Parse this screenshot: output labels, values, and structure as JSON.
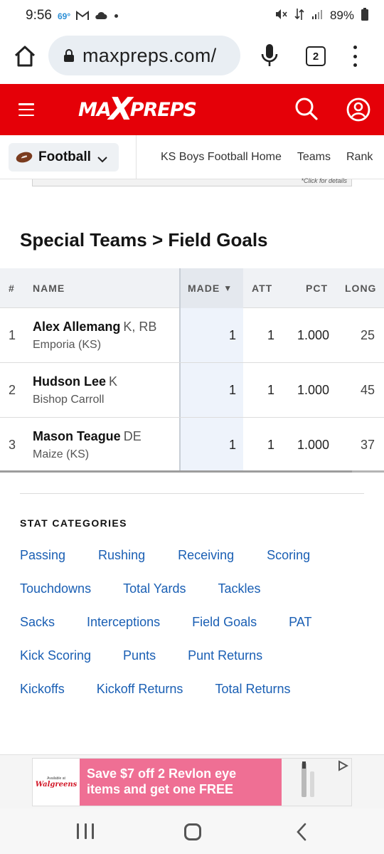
{
  "status": {
    "time": "9:56",
    "temperature": "69°",
    "battery": "89%"
  },
  "browser": {
    "url": "maxpreps.com/",
    "tab_count": "2"
  },
  "header": {
    "logo_left": "MA",
    "logo_x": "X",
    "logo_right": "PREPS"
  },
  "subnav": {
    "sport": "Football",
    "links": [
      "KS Boys Football Home",
      "Teams",
      "Rank"
    ]
  },
  "ad_top": {
    "text": "*Click for details"
  },
  "page": {
    "title": "Special Teams > Field Goals"
  },
  "table": {
    "headers": {
      "num": "#",
      "name": "NAME",
      "made": "MADE",
      "sort_indicator": "▼",
      "att": "ATT",
      "pct": "PCT",
      "long": "LONG"
    },
    "rows": [
      {
        "rank": "1",
        "name": "Alex Allemang",
        "position": "K, RB",
        "school": "Emporia (KS)",
        "made": "1",
        "att": "1",
        "pct": "1.000",
        "long": "25"
      },
      {
        "rank": "2",
        "name": "Hudson Lee",
        "position": "K",
        "school": "Bishop Carroll",
        "made": "1",
        "att": "1",
        "pct": "1.000",
        "long": "45"
      },
      {
        "rank": "3",
        "name": "Mason Teague",
        "position": "DE",
        "school": "Maize (KS)",
        "made": "1",
        "att": "1",
        "pct": "1.000",
        "long": "37"
      }
    ]
  },
  "categories": {
    "heading": "STAT CATEGORIES",
    "rows": [
      [
        "Passing",
        "Rushing",
        "Receiving",
        "Scoring"
      ],
      [
        "Touchdowns",
        "Total Yards",
        "Tackles"
      ],
      [
        "Sacks",
        "Interceptions",
        "Field Goals",
        "PAT"
      ],
      [
        "Kick Scoring",
        "Punts",
        "Punt Returns"
      ],
      [
        "Kickoffs",
        "Kickoff Returns",
        "Total Returns"
      ]
    ]
  },
  "ad_bottom": {
    "available_at": "Available at",
    "brand": "Walgreens",
    "line1": "Save $7 off 2 Revlon eye",
    "line2": "items and get one FREE"
  },
  "colors": {
    "brand_red": "#e50008",
    "link_blue": "#1a5fb4",
    "ad_pink": "#ef6f94"
  }
}
